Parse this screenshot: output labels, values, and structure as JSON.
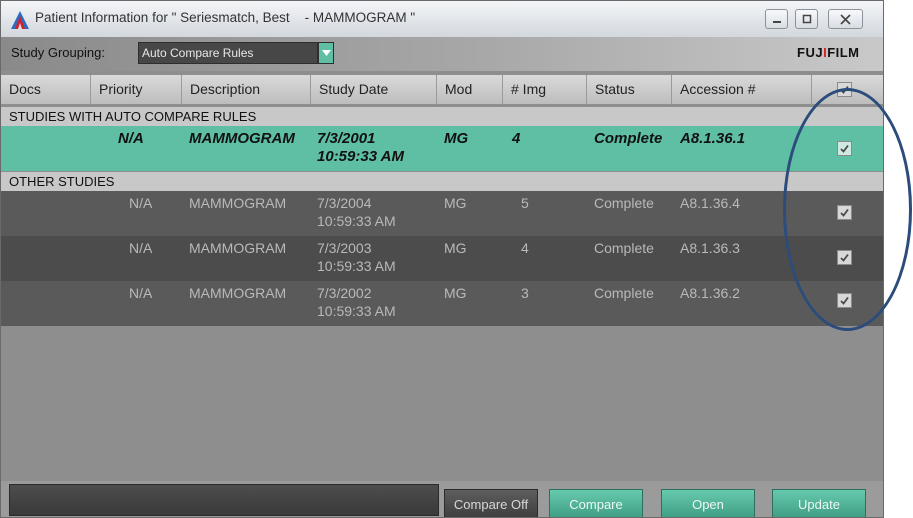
{
  "window": {
    "title": "Patient Information for \" Seriesmatch, Best    - MAMMOGRAM \"",
    "controls": {
      "minimize": "minimize-icon",
      "maximize": "maximize-icon",
      "close": "close-icon"
    }
  },
  "toolbar": {
    "grouping_label": "Study Grouping:",
    "grouping_value": "Auto Compare Rules",
    "brand": {
      "main_left": "FUJ",
      "dot": "I",
      "main_right": "FILM"
    }
  },
  "columns": [
    "Docs",
    "Priority",
    "Description",
    "Study Date",
    "Mod",
    "# Img",
    "Status",
    "Accession #"
  ],
  "header_checked": true,
  "groups": [
    {
      "title": "STUDIES WITH AUTO COMPARE RULES",
      "rows": [
        {
          "docs": "",
          "priority": "N/A",
          "description": "MAMMOGRAM",
          "date": "7/3/2001",
          "time": "10:59:33 AM",
          "mod": "MG",
          "img": "4",
          "status": "Complete",
          "accession": "A8.1.36.1",
          "checked": true
        }
      ]
    },
    {
      "title": "OTHER STUDIES",
      "rows": [
        {
          "docs": "",
          "priority": "N/A",
          "description": "MAMMOGRAM",
          "date": "7/3/2004",
          "time": "10:59:33 AM",
          "mod": "MG",
          "img": "5",
          "status": "Complete",
          "accession": "A8.1.36.4",
          "checked": true
        },
        {
          "docs": "",
          "priority": "N/A",
          "description": "MAMMOGRAM",
          "date": "7/3/2003",
          "time": "10:59:33 AM",
          "mod": "MG",
          "img": "4",
          "status": "Complete",
          "accession": "A8.1.36.3",
          "checked": true
        },
        {
          "docs": "",
          "priority": "N/A",
          "description": "MAMMOGRAM",
          "date": "7/3/2002",
          "time": "10:59:33 AM",
          "mod": "MG",
          "img": "3",
          "status": "Complete",
          "accession": "A8.1.36.2",
          "checked": true
        }
      ]
    }
  ],
  "buttons": {
    "compare_off": "Compare Off",
    "compare": "Compare",
    "open": "Open",
    "update": "Update"
  },
  "colors": {
    "accent": "#5fbfa5",
    "window_bg": "#8e8e8e",
    "row_dark": "#5a5a5a",
    "annotation": "#2c4c7c",
    "brand_accent": "#d2222a"
  }
}
